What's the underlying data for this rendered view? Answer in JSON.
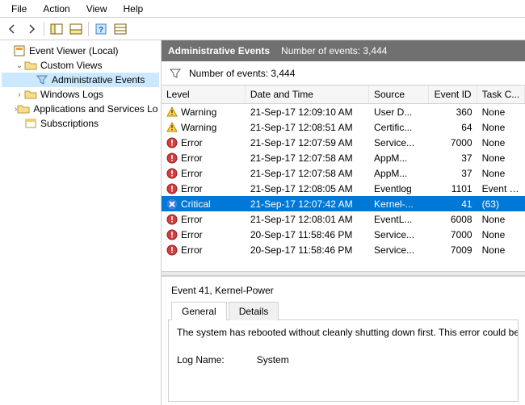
{
  "menu": {
    "file": "File",
    "action": "Action",
    "view": "View",
    "help": "Help"
  },
  "tree": {
    "root": "Event Viewer (Local)",
    "customViews": "Custom Views",
    "adminEvents": "Administrative Events",
    "windowsLogs": "Windows Logs",
    "appsServices": "Applications and Services Lo",
    "subscriptions": "Subscriptions"
  },
  "header": {
    "title": "Administrative Events",
    "countLabel": "Number of events: 3,444"
  },
  "filter": {
    "countLabel": "Number of events: 3,444"
  },
  "columns": {
    "level": "Level",
    "date": "Date and Time",
    "source": "Source",
    "eventId": "Event ID",
    "task": "Task C..."
  },
  "events": [
    {
      "level": "Warning",
      "date": "21-Sep-17 12:09:10 AM",
      "source": "User D...",
      "id": "360",
      "task": "None"
    },
    {
      "level": "Warning",
      "date": "21-Sep-17 12:08:51 AM",
      "source": "Certific...",
      "id": "64",
      "task": "None"
    },
    {
      "level": "Error",
      "date": "21-Sep-17 12:07:59 AM",
      "source": "Service...",
      "id": "7000",
      "task": "None"
    },
    {
      "level": "Error",
      "date": "21-Sep-17 12:07:58 AM",
      "source": "AppM...",
      "id": "37",
      "task": "None"
    },
    {
      "level": "Error",
      "date": "21-Sep-17 12:07:58 AM",
      "source": "AppM...",
      "id": "37",
      "task": "None"
    },
    {
      "level": "Error",
      "date": "21-Sep-17 12:08:05 AM",
      "source": "Eventlog",
      "id": "1101",
      "task": "Event p..."
    },
    {
      "level": "Critical",
      "date": "21-Sep-17 12:07:42 AM",
      "source": "Kernel-...",
      "id": "41",
      "task": "(63)",
      "selected": true
    },
    {
      "level": "Error",
      "date": "21-Sep-17 12:08:01 AM",
      "source": "EventL...",
      "id": "6008",
      "task": "None"
    },
    {
      "level": "Error",
      "date": "20-Sep-17 11:58:46 PM",
      "source": "Service...",
      "id": "7000",
      "task": "None"
    },
    {
      "level": "Error",
      "date": "20-Sep-17 11:58:46 PM",
      "source": "Service...",
      "id": "7009",
      "task": "None"
    }
  ],
  "detail": {
    "title": "Event 41, Kernel-Power",
    "tabs": {
      "general": "General",
      "details": "Details"
    },
    "description": "The system has rebooted without cleanly shutting down first. This error could be",
    "logNameLabel": "Log Name:",
    "logNameValue": "System"
  }
}
